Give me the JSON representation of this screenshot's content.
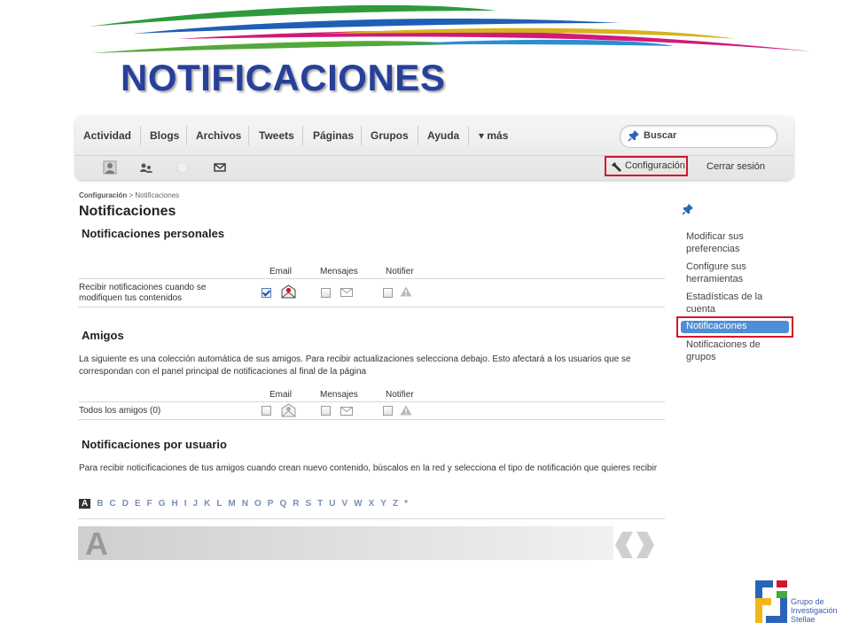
{
  "slide": {
    "title": "NOTIFICACIONES"
  },
  "colors": {
    "accent": "#27409a",
    "highlight": "#d0182a",
    "active": "#4d8ed6"
  },
  "topnav": {
    "items": [
      "Actividad",
      "Blogs",
      "Archivos",
      "Tweets",
      "Páginas",
      "Grupos",
      "Ayuda",
      "▾ más"
    ],
    "search_placeholder": "Buscar"
  },
  "subnav": {
    "icons": [
      "profile-icon",
      "friends-icon",
      "status-icon",
      "messages-icon"
    ],
    "settings_label": "Configuración",
    "logout_label": "Cerrar sesión"
  },
  "breadcrumb": {
    "parent": "Configuración",
    "sep": ">",
    "current": "Notificaciones"
  },
  "page_title": "Notificaciones",
  "personal": {
    "heading": "Notificaciones personales",
    "columns": [
      "Email",
      "Mensajes",
      "Notifier"
    ],
    "row_label": "Recibir notificaciones cuando se modifiquen tus contenidos",
    "email_checked": true,
    "messages_checked": false,
    "notifier_checked": false
  },
  "friends": {
    "heading": "Amigos",
    "description": "La siguiente es una colección automática de sus amigos. Para recibir actualizaciones selecciona debajo. Esto afectará a los usuarios que se correspondan con el panel principal de notificaciones al final de la página",
    "columns": [
      "Email",
      "Mensajes",
      "Notifier"
    ],
    "row_label": "Todos los amigos (0)",
    "email_checked": false,
    "messages_checked": false,
    "notifier_checked": false
  },
  "per_user": {
    "heading": "Notificaciones por usuario",
    "description": "Para recibir noticificaciones de tus amigos cuando crean nuevo contenido, búscalos en la red y selecciona el tipo de notificación que quieres recibir",
    "letters": [
      "A",
      "B",
      "C",
      "D",
      "E",
      "F",
      "G",
      "H",
      "I",
      "J",
      "K",
      "L",
      "M",
      "N",
      "O",
      "P",
      "Q",
      "R",
      "S",
      "T",
      "U",
      "V",
      "W",
      "X",
      "Y",
      "Z",
      "*"
    ],
    "active_letter": "A",
    "section_letter": "A"
  },
  "sidebar": {
    "items": [
      {
        "label": "Modificar sus preferencias"
      },
      {
        "label": "Configure sus herramientas"
      },
      {
        "label": "Estadísticas de la cuenta"
      },
      {
        "label": "Notificaciones"
      },
      {
        "label": "Notificaciones de grupos"
      }
    ]
  },
  "logo": {
    "line1": "Grupo de",
    "line2": "Investigación",
    "line3": "Stellae"
  }
}
